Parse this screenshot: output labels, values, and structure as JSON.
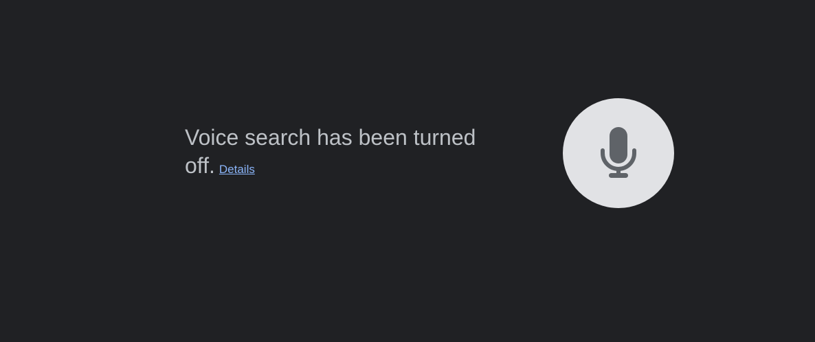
{
  "message": {
    "text_line1": "Voice search has been turned",
    "text_line2": "off.",
    "details_link": "Details"
  },
  "mic": {
    "icon": "microphone-icon",
    "bg_color": "#e1e2e5",
    "icon_color": "#5f6368"
  },
  "theme": {
    "background": "#202124",
    "text_color": "#bdc1c6",
    "link_color": "#8ab4f8"
  }
}
